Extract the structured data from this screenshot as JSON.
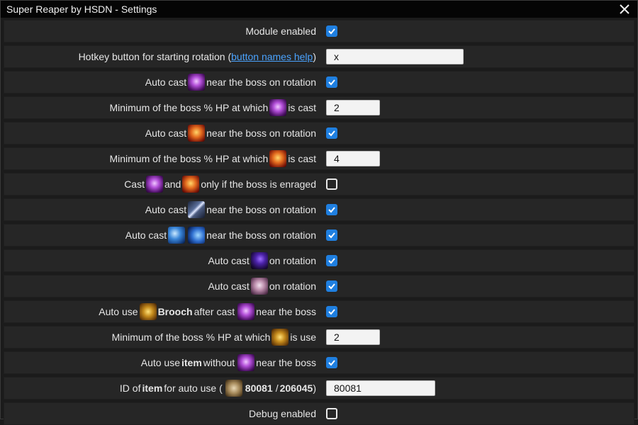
{
  "window": {
    "title": "Super Reaper by HSDN - Settings"
  },
  "rows": {
    "module_enabled": {
      "label": "Module enabled",
      "checked": true
    },
    "hotkey": {
      "label_pre": "Hotkey button for starting rotation (",
      "link": "button names help",
      "label_post": ")",
      "value": "x"
    },
    "autocast1": {
      "pre": "Auto cast",
      "post": "near the boss on rotation",
      "icon": "purple-skill-icon",
      "checked": true
    },
    "minhp1": {
      "pre": "Minimum of the boss % HP at which",
      "post": "is cast",
      "icon": "purple-skill-icon",
      "value": "2"
    },
    "autocast2": {
      "pre": "Auto cast",
      "post": "near the boss on rotation",
      "icon": "red-skill-icon",
      "checked": true
    },
    "minhp2": {
      "pre": "Minimum of the boss % HP at which",
      "post": "is cast",
      "icon": "red-skill-icon",
      "value": "4"
    },
    "enraged": {
      "pre": "Cast",
      "mid": "and",
      "post": "only if the boss is enraged",
      "checked": false
    },
    "autocast3": {
      "pre": "Auto cast",
      "post": "near the boss on rotation",
      "icon": "slash-skill-icon",
      "checked": true
    },
    "autocast4": {
      "pre": "Auto cast",
      "post": "near the boss on rotation",
      "checked": true
    },
    "autocast5": {
      "pre": "Auto cast",
      "post": "on rotation",
      "icon": "dark-skill-icon",
      "checked": true
    },
    "autocast6": {
      "pre": "Auto cast",
      "post": "on rotation",
      "icon": "skull-skill-icon",
      "checked": true
    },
    "brooch": {
      "pre": "Auto use",
      "bold": "Brooch",
      "mid": "after cast",
      "post": "near the boss",
      "checked": true
    },
    "minhp3": {
      "pre": "Minimum of the boss % HP at which",
      "post": "is use",
      "value": "2"
    },
    "item_without": {
      "pre": "Auto use",
      "bold": "item",
      "mid": "without",
      "post": "near the boss",
      "checked": true
    },
    "item_id": {
      "pre": "ID of",
      "bold": "item",
      "mid": "for auto use (",
      "id1": "80081",
      "sep": "/",
      "id2": "206045",
      "post": ")",
      "value": "80081"
    },
    "debug": {
      "label": "Debug enabled",
      "checked": false
    }
  }
}
